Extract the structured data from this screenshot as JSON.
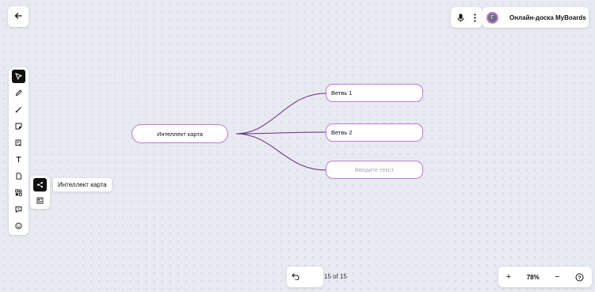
{
  "board": {
    "title": "Онлайн-доска MyBoards",
    "avatar_letter": "Г"
  },
  "toolbar": {
    "tools": [
      "cursor-icon",
      "pen-icon",
      "line-icon",
      "sticker-icon",
      "comment-note-icon",
      "text-icon",
      "document-icon",
      "shapes-icon",
      "chat-icon",
      "emoji-icon"
    ],
    "active": "cursor-icon"
  },
  "submenu": {
    "items": [
      "mindmap-icon",
      "template-icon"
    ],
    "tooltip": "Интеллект карта"
  },
  "mindmap": {
    "root": "Интеллект карта",
    "branches": [
      "Ветвь 1",
      "Ветвь 2"
    ],
    "new_branch_placeholder": "Введите текст",
    "line_color": "#6b2a7a",
    "node_border_color": "#c27ad0"
  },
  "footer": {
    "page_counter": "15 of 15",
    "zoom": "78%",
    "zoom_in": "+",
    "zoom_out": "−",
    "help": "?"
  }
}
